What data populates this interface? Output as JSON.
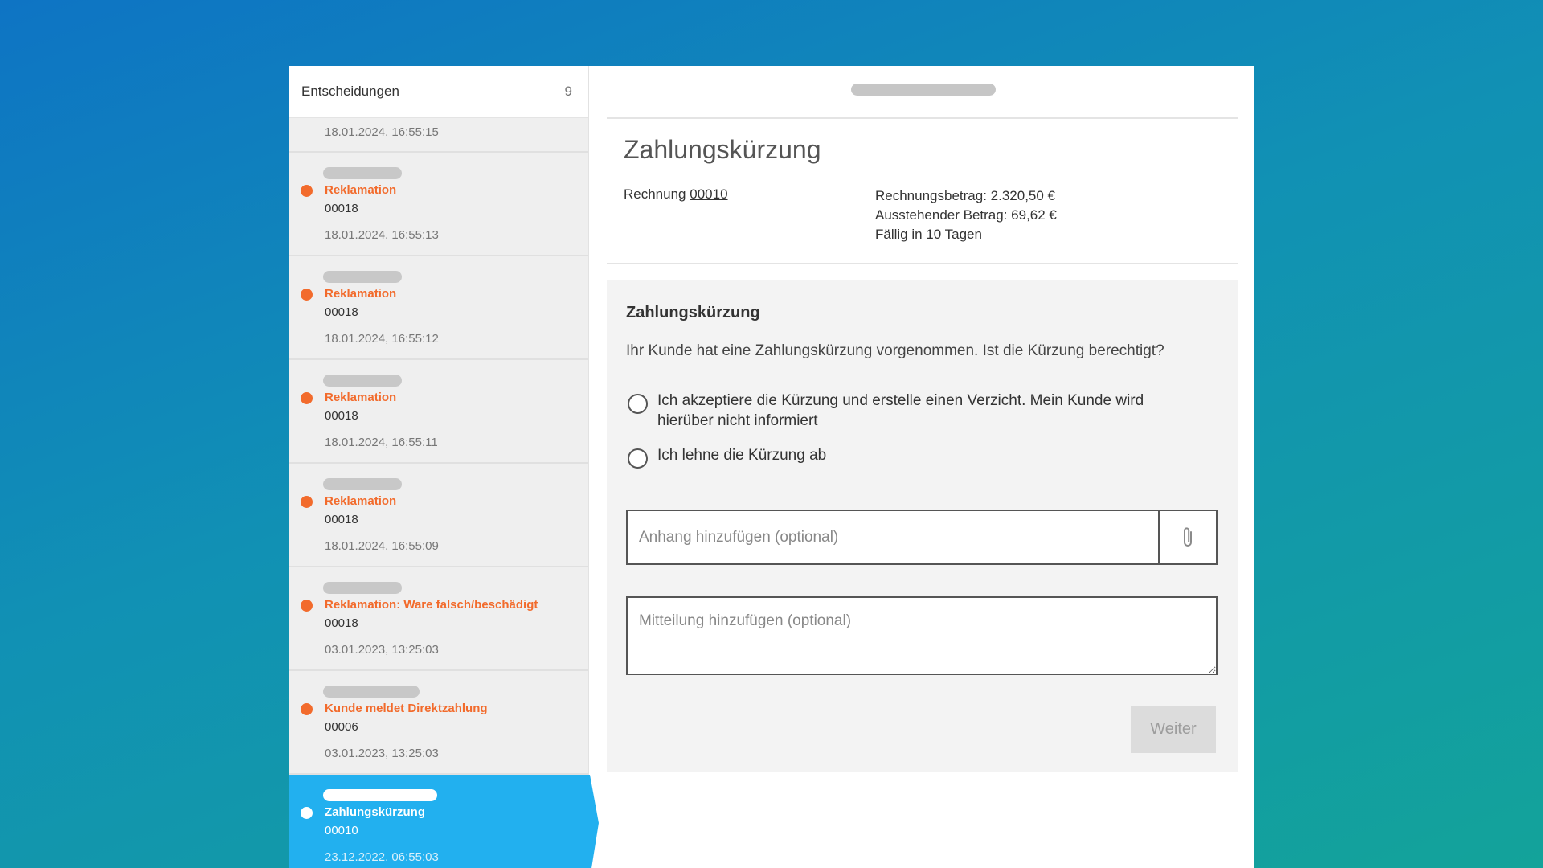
{
  "sidebar": {
    "header": {
      "label": "Entscheidungen",
      "count": "9"
    },
    "first_timestamp": "18.01.2024, 16:55:15",
    "items": [
      {
        "title": "Reklamation",
        "number": "00018",
        "timestamp": "18.01.2024, 16:55:13",
        "status_color": "#f26b2c"
      },
      {
        "title": "Reklamation",
        "number": "00018",
        "timestamp": "18.01.2024, 16:55:12",
        "status_color": "#f26b2c"
      },
      {
        "title": "Reklamation",
        "number": "00018",
        "timestamp": "18.01.2024, 16:55:11",
        "status_color": "#f26b2c"
      },
      {
        "title": "Reklamation",
        "number": "00018",
        "timestamp": "18.01.2024, 16:55:09",
        "status_color": "#f26b2c"
      },
      {
        "title": "Reklamation: Ware falsch/beschädigt",
        "number": "00018",
        "timestamp": "03.01.2023, 13:25:03",
        "status_color": "#f26b2c"
      },
      {
        "title": "Kunde meldet Direktzahlung",
        "number": "00006",
        "timestamp": "03.01.2023, 13:25:03",
        "status_color": "#f26b2c"
      },
      {
        "title": "Zahlungskürzung",
        "number": "00010",
        "timestamp": "23.12.2022, 06:55:03",
        "active": true,
        "active_color": "#22b0ef"
      }
    ]
  },
  "main": {
    "title": "Zahlungskürzung",
    "invoice_label": "Rechnung",
    "invoice_number": "00010",
    "invoice_amount": "Rechnungsbetrag: 2.320,50 €",
    "outstanding_amount": "Ausstehender Betrag: 69,62 €",
    "due": "Fällig in 10 Tagen",
    "panel": {
      "heading": "Zahlungskürzung",
      "question": "Ihr Kunde hat eine Zahlungskürzung vorgenommen. Ist die Kürzung berechtigt?",
      "options": [
        "Ich akzeptiere die Kürzung und erstelle einen Verzicht. Mein Kunde wird hierüber nicht informiert",
        "Ich lehne die Kürzung ab"
      ],
      "attachment_placeholder": "Anhang hinzufügen (optional)",
      "attachment_icon": "paperclip-icon",
      "message_placeholder": "Mitteilung hinzufügen (optional)",
      "submit_label": "Weiter"
    }
  }
}
